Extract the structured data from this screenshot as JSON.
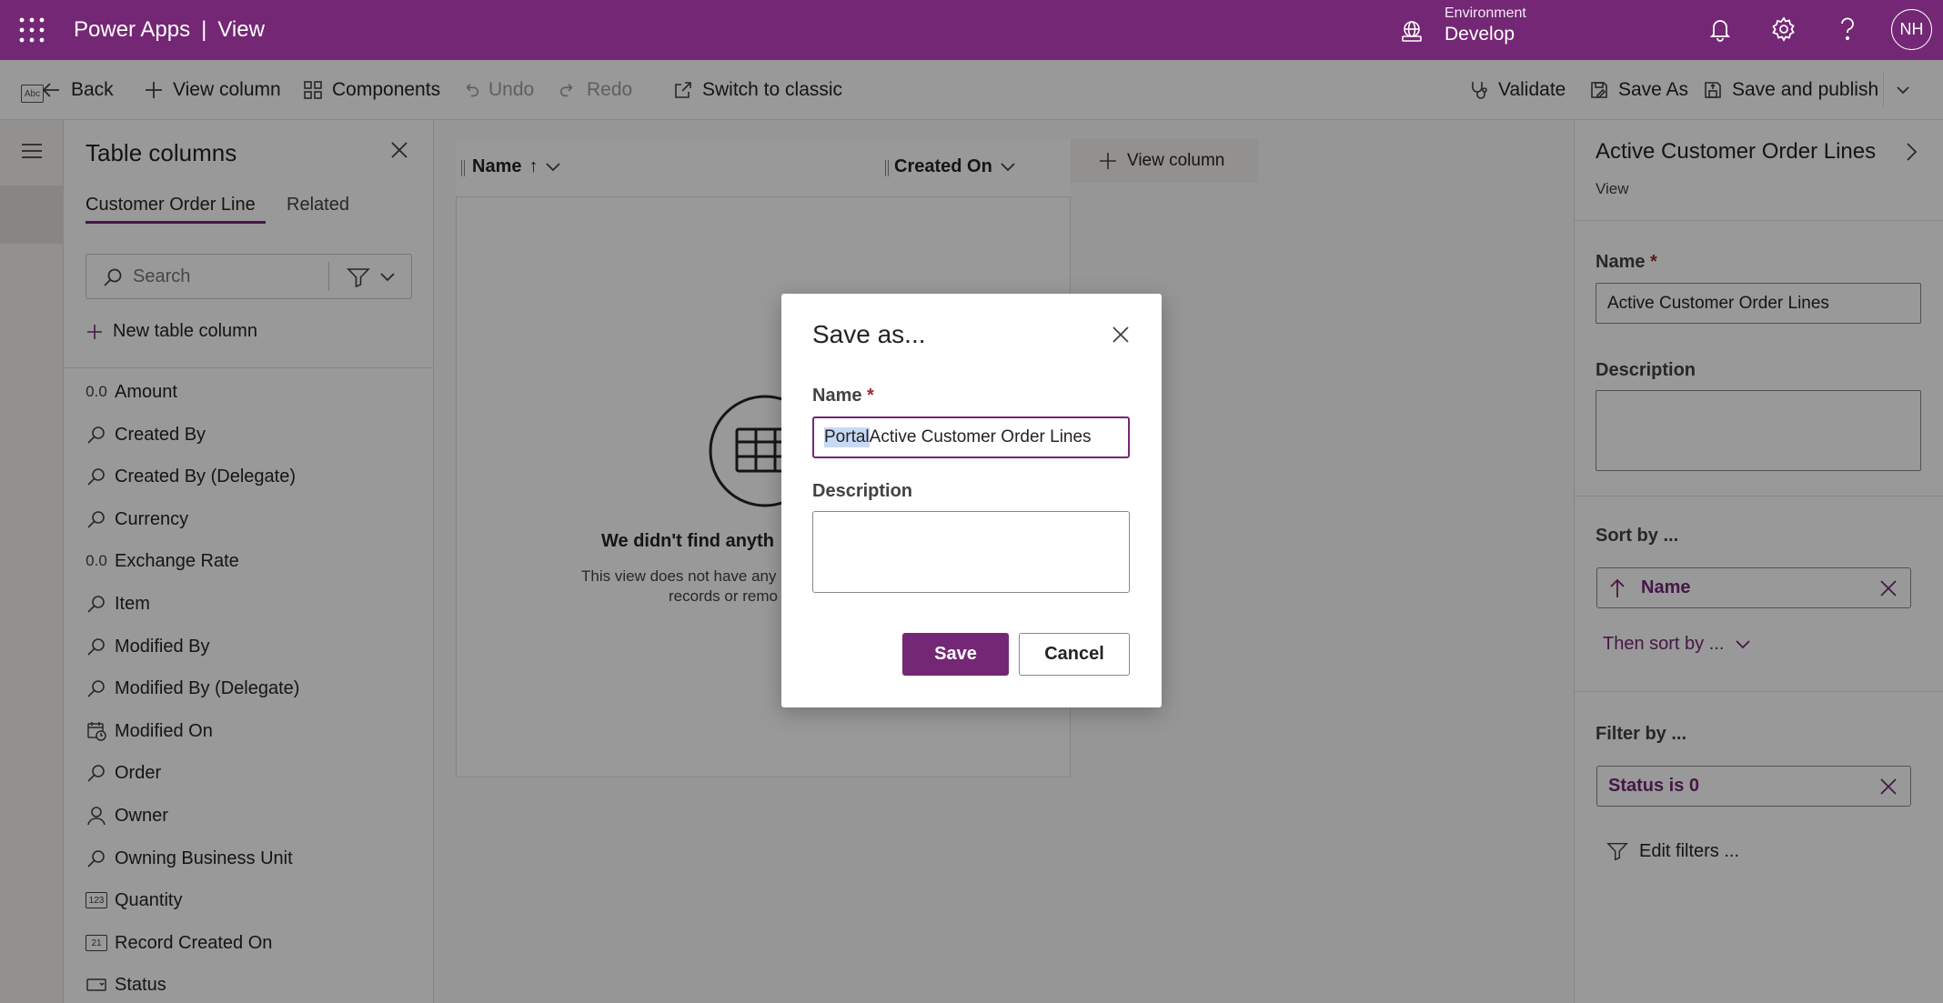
{
  "header": {
    "app_name": "Power Apps",
    "separator": "|",
    "page": "View",
    "environment_label": "Environment",
    "environment_value": "Develop",
    "avatar_initials": "NH",
    "brand_color": "#742774"
  },
  "commands": {
    "back": "Back",
    "view_column": "View column",
    "components": "Components",
    "undo": "Undo",
    "redo": "Redo",
    "switch_classic": "Switch to classic",
    "validate": "Validate",
    "save_as": "Save As",
    "save_publish": "Save and publish"
  },
  "left_rail": {
    "abc_icon_text": "Abc"
  },
  "columns_panel": {
    "title": "Table columns",
    "tabs": [
      {
        "label": "Customer Order Line",
        "active": true
      },
      {
        "label": "Related",
        "active": false
      }
    ],
    "search_placeholder": "Search",
    "new_column": "New table column",
    "fields": [
      {
        "label": "Amount",
        "icon": "decimal-icon",
        "glyph": "0.0"
      },
      {
        "label": "Created By",
        "icon": "lookup-icon"
      },
      {
        "label": "Created By (Delegate)",
        "icon": "lookup-icon"
      },
      {
        "label": "Currency",
        "icon": "lookup-icon"
      },
      {
        "label": "Exchange Rate",
        "icon": "decimal-icon",
        "glyph": "0.0"
      },
      {
        "label": "Item",
        "icon": "lookup-icon"
      },
      {
        "label": "Modified By",
        "icon": "lookup-icon"
      },
      {
        "label": "Modified By (Delegate)",
        "icon": "lookup-icon"
      },
      {
        "label": "Modified On",
        "icon": "calendar-clock-icon"
      },
      {
        "label": "Order",
        "icon": "lookup-icon"
      },
      {
        "label": "Owner",
        "icon": "person-icon"
      },
      {
        "label": "Owning Business Unit",
        "icon": "lookup-icon"
      },
      {
        "label": "Quantity",
        "icon": "number-icon",
        "glyph": "123"
      },
      {
        "label": "Record Created On",
        "icon": "calendar-icon",
        "glyph": "21"
      },
      {
        "label": "Status",
        "icon": "option-set-icon"
      }
    ]
  },
  "grid": {
    "columns": [
      {
        "label": "Name",
        "sort": "↑"
      },
      {
        "label": "Created On",
        "sort": ""
      }
    ],
    "add_column": "View column",
    "empty_title": "We didn't find anyth",
    "empty_desc_line1": "This view does not have any",
    "empty_desc_line2": "records or remo"
  },
  "properties": {
    "title": "Active Customer Order Lines",
    "subtitle": "View",
    "name_label": "Name",
    "required_mark": "*",
    "name_value": "Active Customer Order Lines",
    "description_label": "Description",
    "sort_label": "Sort by ...",
    "sort_field": "Name",
    "then_sort": "Then sort by ...",
    "filter_label": "Filter by ...",
    "filter_value": "Status is 0",
    "edit_filters": "Edit filters ..."
  },
  "dialog": {
    "title": "Save as...",
    "name_label": "Name",
    "required_mark": "*",
    "name_selected": "Portal ",
    "name_rest": "Active Customer Order Lines",
    "description_label": "Description",
    "save": "Save",
    "cancel": "Cancel"
  }
}
